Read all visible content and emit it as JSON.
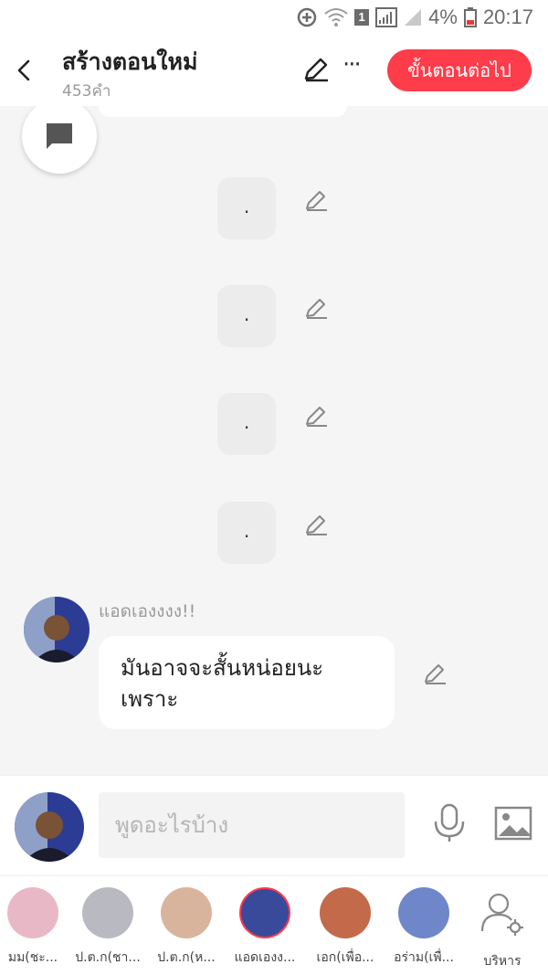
{
  "status_bar": {
    "battery": "4%",
    "time": "20:17",
    "sim_badge": "1"
  },
  "header": {
    "title": "สร้างตอนใหม่",
    "word_count": "453คำ",
    "more_label": "···",
    "next_label": "ขั้นตอนต่อไป"
  },
  "chat": {
    "dot_messages": [
      ".",
      ".",
      ".",
      "."
    ],
    "sender_name": "แอดเองงงง!!",
    "message_text": "มันอาจจะสั้นหน่อยนะเพราะ"
  },
  "composer": {
    "placeholder": "พูดอะไรบ้าง"
  },
  "characters": [
    {
      "name": "มม(ชะ...",
      "color": "#e9b8c6"
    },
    {
      "name": "ป.ต.ก(ชา...",
      "color": "#b9b9c2"
    },
    {
      "name": "ป.ต.ก(ห...",
      "color": "#d9b49c"
    },
    {
      "name": "แอดเองง...",
      "color": "#3a4a9a"
    },
    {
      "name": "เอก(เพื่อ...",
      "color": "#c26a4a"
    },
    {
      "name": "อร่าม(เพื่...",
      "color": "#6f86c9"
    }
  ],
  "manage_label": "บริหาร",
  "colors": {
    "accent": "#fe3c4a",
    "background": "#f5f5f5"
  }
}
